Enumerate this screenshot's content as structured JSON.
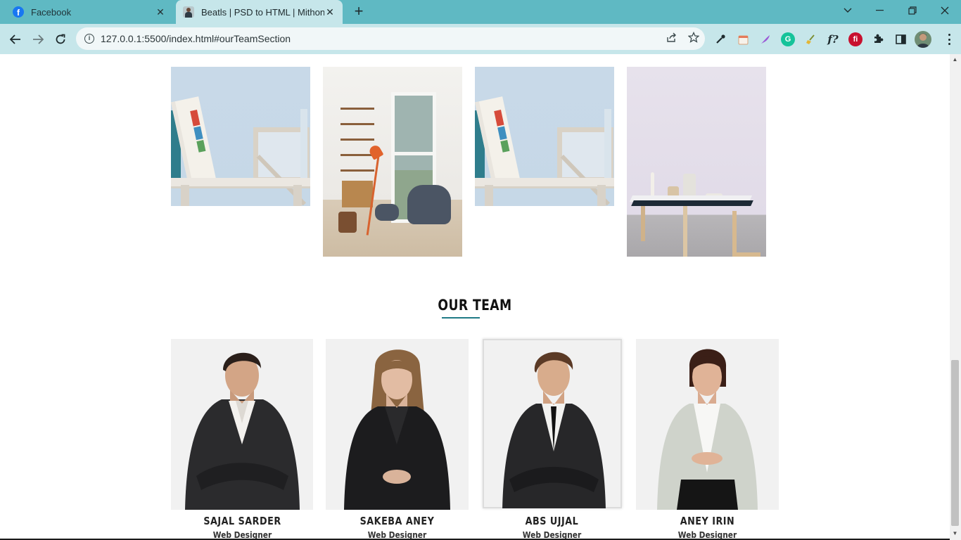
{
  "browser": {
    "tabs": [
      {
        "title": "Facebook",
        "favicon": "facebook-icon",
        "active": false
      },
      {
        "title": "Beatls | PSD to HTML | Mithon",
        "favicon": "person-avatar-icon",
        "active": true
      }
    ],
    "new_tab_label": "+",
    "url": "127.0.0.1:5500/index.html#ourTeamSection",
    "colors": {
      "tabstrip": "#5fb9c3",
      "toolbar": "#c6e6ea"
    },
    "extensions": [
      "eyedropper-icon",
      "calendar-icon",
      "feather-icon",
      "grammarly-icon",
      "broom-icon",
      "font-identifier-icon",
      "fi-icon",
      "puzzle-icon",
      "side-panel-icon",
      "profile-avatar"
    ]
  },
  "gallery": {
    "images": [
      "shelf-with-book",
      "living-room-chairs",
      "shelf-with-book",
      "dining-table"
    ]
  },
  "team": {
    "title": "OUR TEAM",
    "accent": "#1f7a86",
    "members": [
      {
        "name": "SAJAL SARDER",
        "role": "Web Designer"
      },
      {
        "name": "SAKEBA ANEY",
        "role": "Web Designer"
      },
      {
        "name": "ABS UJJAL",
        "role": "Web Designer"
      },
      {
        "name": "ANEY IRIN",
        "role": "Web Designer"
      }
    ]
  }
}
